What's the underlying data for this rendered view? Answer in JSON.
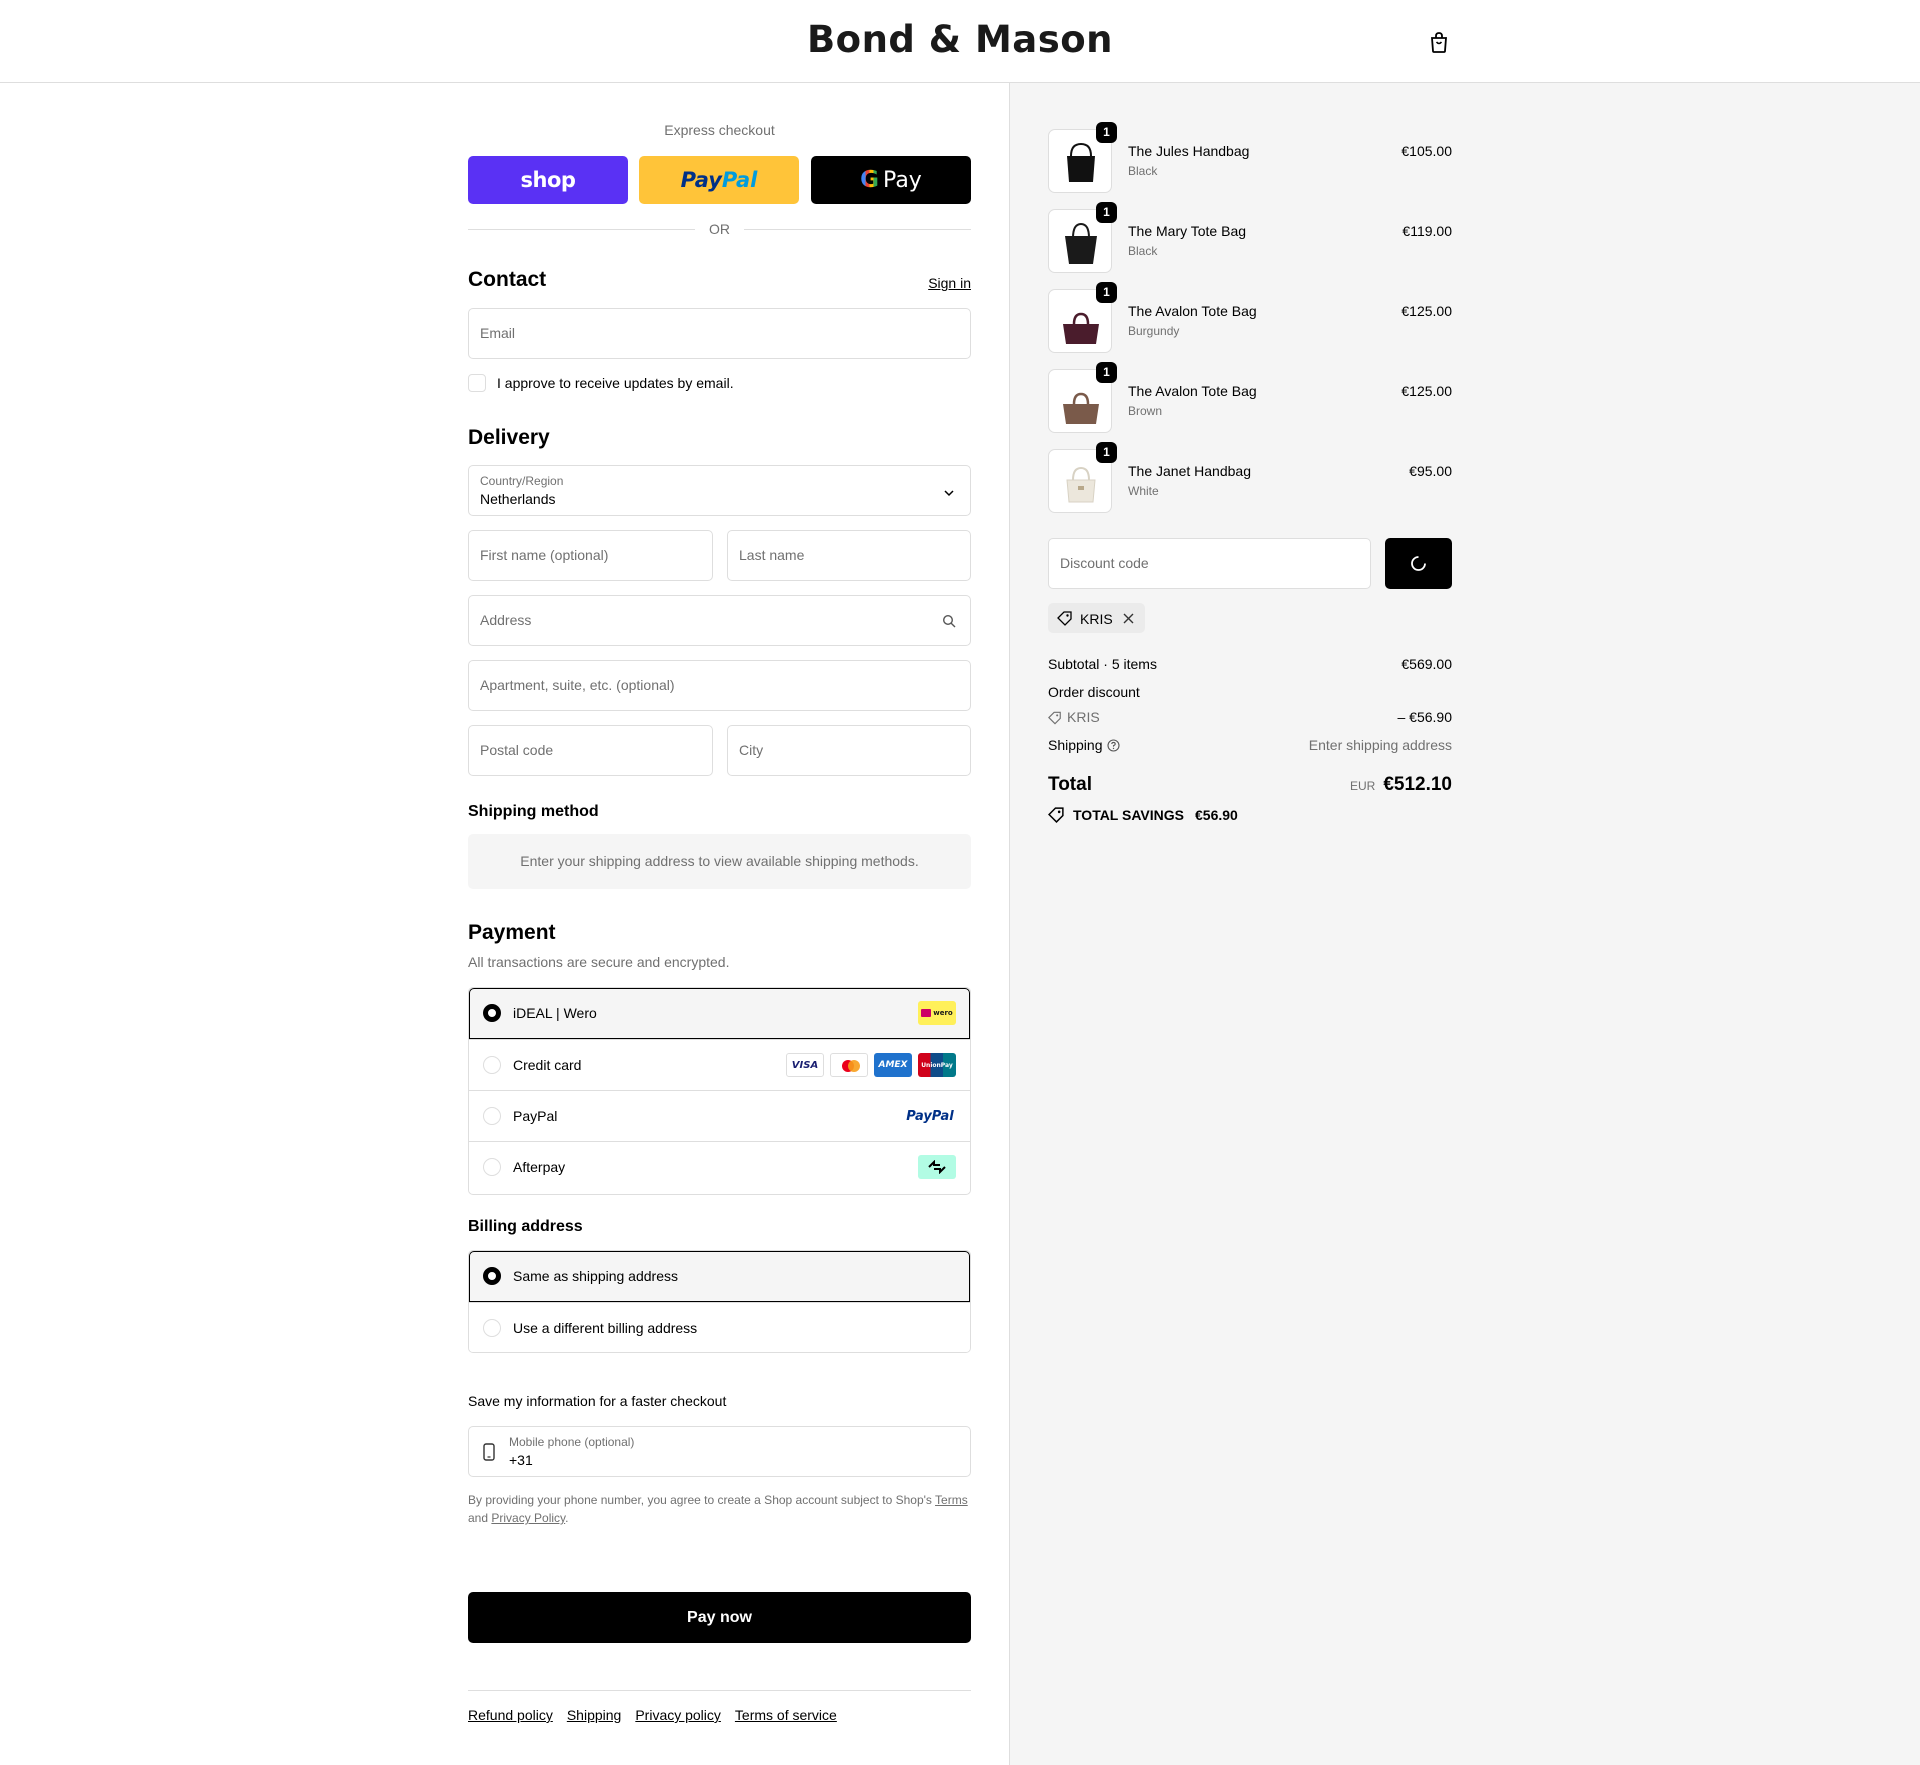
{
  "store": {
    "name": "Bond & Mason",
    "cart_icon": "bag-icon"
  },
  "express": {
    "label": "Express checkout",
    "shop_label": "shop",
    "paypal_part1": "Pay",
    "paypal_part2": "Pal",
    "gpay_g": "G",
    "gpay_label": "Pay",
    "or": "OR"
  },
  "contact": {
    "title": "Contact",
    "sign_in": "Sign in",
    "email_placeholder": "Email",
    "marketing_label": "I approve to receive updates by email."
  },
  "delivery": {
    "title": "Delivery",
    "country_label": "Country/Region",
    "country_value": "Netherlands",
    "first_name_placeholder": "First name (optional)",
    "last_name_placeholder": "Last name",
    "address_placeholder": "Address",
    "apartment_placeholder": "Apartment, suite, etc. (optional)",
    "postal_placeholder": "Postal code",
    "city_placeholder": "City"
  },
  "shipping_method": {
    "title": "Shipping method",
    "message": "Enter your shipping address to view available shipping methods."
  },
  "payment": {
    "title": "Payment",
    "subtitle": "All transactions are secure and encrypted.",
    "methods": [
      {
        "label": "iDEAL | Wero",
        "selected": true,
        "badge_text": "wero"
      },
      {
        "label": "Credit card",
        "selected": false,
        "badges": [
          "VISA",
          "mastercard",
          "AMEX",
          "UnionPay"
        ]
      },
      {
        "label": "PayPal",
        "selected": false,
        "badge_text": "PayPal"
      },
      {
        "label": "Afterpay",
        "selected": false,
        "badge_icon": "afterpay-icon"
      }
    ]
  },
  "billing": {
    "title": "Billing address",
    "options": [
      {
        "label": "Same as shipping address",
        "selected": true
      },
      {
        "label": "Use a different billing address",
        "selected": false
      }
    ]
  },
  "save_info": {
    "title": "Save my information for a faster checkout",
    "phone_label": "Mobile phone (optional)",
    "phone_value": "+31",
    "legal_text": "By providing your phone number, you agree to create a Shop account subject to Shop's",
    "terms": "Terms",
    "and": "and",
    "privacy": "Privacy Policy",
    "period": "."
  },
  "pay_now": "Pay now",
  "footer": [
    "Refund policy",
    "Shipping",
    "Privacy policy",
    "Terms of service"
  ],
  "summary": {
    "items": [
      {
        "name": "The Jules Handbag",
        "variant": "Black",
        "price": "€105.00",
        "qty": "1",
        "color": "#111111"
      },
      {
        "name": "The Mary Tote Bag",
        "variant": "Black",
        "price": "€119.00",
        "qty": "1",
        "color": "#1a1a1a"
      },
      {
        "name": "The Avalon Tote Bag",
        "variant": "Burgundy",
        "price": "€125.00",
        "qty": "1",
        "color": "#4a1c2c"
      },
      {
        "name": "The Avalon Tote Bag",
        "variant": "Brown",
        "price": "€125.00",
        "qty": "1",
        "color": "#7a5a4a"
      },
      {
        "name": "The Janet Handbag",
        "variant": "White",
        "price": "€95.00",
        "qty": "1",
        "color": "#ece7dc"
      }
    ],
    "discount_placeholder": "Discount code",
    "applied_code": "KRIS",
    "subtotal_label": "Subtotal · 5 items",
    "subtotal_value": "€569.00",
    "order_discount_label": "Order discount",
    "discount_code": "KRIS",
    "discount_value": "– €56.90",
    "shipping_label": "Shipping",
    "shipping_value": "Enter shipping address",
    "total_label": "Total",
    "currency": "EUR",
    "total_value": "€512.10",
    "savings_label": "TOTAL SAVINGS",
    "savings_value": "€56.90"
  }
}
